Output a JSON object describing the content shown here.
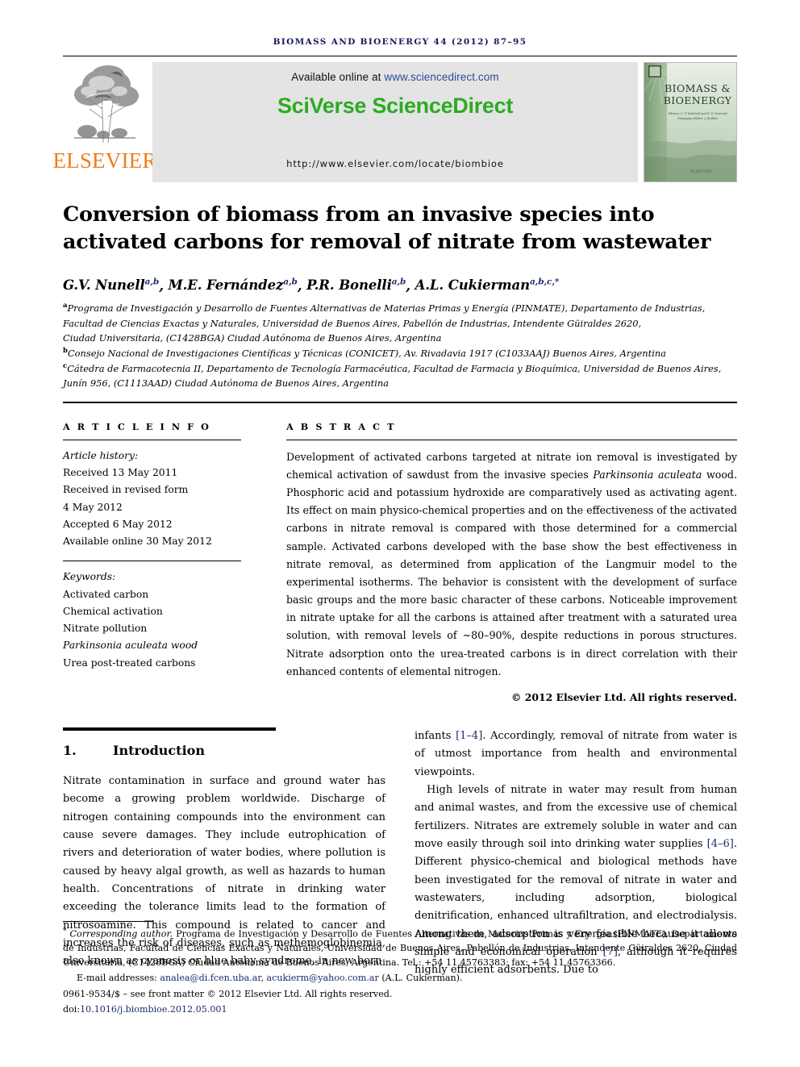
{
  "running_head": "BIOMASS AND BIOENERGY 44 (2012) 87–95",
  "masthead": {
    "publisher_name": "ELSEVIER",
    "available_prefix": "Available online at ",
    "available_url": "www.sciencedirect.com",
    "platform_logo": "SciVerse ScienceDirect",
    "homepage_url": "http://www.elsevier.com/locate/biombioe",
    "cover": {
      "line1": "BIOMASS &",
      "line2": "BIOENERGY",
      "editors_line1": "Editors: C. P. Mitchell and R. P. Overend",
      "editors_line2": "Managing Editor: J. Bailliet",
      "publisher_mark": "ELSEVIER"
    },
    "banner_bg": "#e4e4e4",
    "logo_color": "#2cab22",
    "elsevier_color": "#ef7d1a"
  },
  "article": {
    "title": "Conversion of biomass from an invasive species into activated carbons for removal of nitrate from wastewater",
    "authors": [
      {
        "name": "G.V. Nunell",
        "sup": "a,b"
      },
      {
        "name": "M.E. Fernández",
        "sup": "a,b"
      },
      {
        "name": "P.R. Bonelli",
        "sup": "a,b"
      },
      {
        "name": "A.L. Cukierman",
        "sup": "a,b,c,*"
      }
    ],
    "affiliations": [
      {
        "mark": "a",
        "lines": [
          "Programa de Investigación y Desarrollo de Fuentes Alternativas de Materias Primas y Energía (PINMATE), Departamento de Industrias,",
          "Facultad de Ciencias Exactas y Naturales, Universidad de Buenos Aires, Pabellón de Industrias, Intendente Güiraldes 2620,",
          "Ciudad Universitaria, (C1428BGA) Ciudad Autónoma de Buenos Aires, Argentina"
        ]
      },
      {
        "mark": "b",
        "lines": [
          "Consejo Nacional de Investigaciones Científicas y Técnicas (CONICET), Av. Rivadavia 1917 (C1033AAJ) Buenos Aires, Argentina"
        ]
      },
      {
        "mark": "c",
        "lines": [
          "Cátedra de Farmacotecnia II, Departamento de Tecnología Farmacéutica, Facultad de Farmacia y Bioquímica, Universidad de Buenos Aires,",
          "Junín 956, (C1113AAD) Ciudad Autónoma de Buenos Aires, Argentina"
        ]
      }
    ]
  },
  "article_info": {
    "heading": "A R T I C L E   I N F O",
    "history_label": "Article history:",
    "history": [
      "Received 13 May 2011",
      "Received in revised form",
      "4 May 2012",
      "Accepted 6 May 2012",
      "Available online 30 May 2012"
    ],
    "keywords_label": "Keywords:",
    "keywords": [
      {
        "text": "Activated carbon",
        "italic": false
      },
      {
        "text": "Chemical activation",
        "italic": false
      },
      {
        "text": "Nitrate pollution",
        "italic": false
      },
      {
        "text": "Parkinsonia aculeata wood",
        "italic": true
      },
      {
        "text": "Urea post-treated carbons",
        "italic": false
      }
    ]
  },
  "abstract": {
    "heading": "A B S T R A C T",
    "part1": "Development of activated carbons targeted at nitrate ion removal is investigated by chemical activation of sawdust from the invasive species ",
    "species": "Parkinsonia aculeata",
    "part2": " wood. Phosphoric acid and potassium hydroxide are comparatively used as activating agent. Its effect on main physico-chemical properties and on the effectiveness of the activated carbons in nitrate removal is compared with those determined for a commercial sample. Activated carbons developed with the base show the best effectiveness in nitrate removal, as determined from application of the Langmuir model to the experimental isotherms. The behavior is consistent with the development of surface basic groups and the more basic character of these carbons. Noticeable improvement in nitrate uptake for all the carbons is attained after treatment with a saturated urea solution, with removal levels of ~80–90%, despite reductions in porous structures. Nitrate adsorption onto the urea-treated carbons is in direct correlation with their enhanced contents of elemental nitrogen.",
    "copyright": "© 2012 Elsevier Ltd. All rights reserved."
  },
  "introduction": {
    "number": "1.",
    "title": "Introduction",
    "left_p1": "Nitrate contamination in surface and ground water has become a growing problem worldwide. Discharge of nitrogen containing compounds into the environment can cause severe damages. They include eutrophication of rivers and deterioration of water bodies, where pollution is caused by heavy algal growth, as well as hazards to human health. Concentrations of nitrate in drinking water exceeding the tolerance limits lead to the formation of nitrosoamine. This compound is related to cancer and increases the risk of diseases, such as methemoglobinemia, also known as cyanosis or blue baby syndrome, in new born",
    "right_p1_start": "infants ",
    "right_ref1": "[1–4]",
    "right_p1_end": ". Accordingly, removal of nitrate from water is of utmost importance from health and environmental viewpoints.",
    "right_p2_a": "High levels of nitrate in water may result from human and animal wastes, and from the excessive use of chemical fertilizers. Nitrates are extremely soluble in water and can move easily through soil into drinking water supplies ",
    "right_ref2": "[4–6]",
    "right_p2_b": ". Different physico-chemical and biological methods have been investigated for the removal of nitrate in water and wastewaters, including adsorption, biological denitrification, enhanced ultrafiltration, and electrodialysis. Among them, adsorption is very feasible because it allows simple and economical operation ",
    "right_ref3": "[7]",
    "right_p2_c": ", although it requires highly efficient adsorbents. Due to"
  },
  "footnote": {
    "star": "*",
    "corr_label": "Corresponding author.",
    "corr_text": " Programa de Investigación y Desarrollo de Fuentes Alternativas de Materias Primas y Energía (PINMATE), Departamento de Industrias, Facultad de Ciencias Exactas y Naturales, Universidad de Buenos Aires, Pabellón de Industrias, Intendente Güiraldes 2620, Ciudad Universitaria, (C1428BGA) Ciudad Autónoma de Buenos Aires, Argentina. Tel.: +54 11 45763383; fax: +54 11 45763366.",
    "email_label": "E-mail addresses:",
    "email1": "analea@di.fcen.uba.ar",
    "email2": "acukierm@yahoo.com.ar",
    "email_attrib": "(A.L. Cukierman).",
    "front_matter": "0961-9534/$ – see front matter © 2012 Elsevier Ltd. All rights reserved.",
    "doi_label": "doi:",
    "doi_value": "10.1016/j.biombioe.2012.05.001"
  }
}
